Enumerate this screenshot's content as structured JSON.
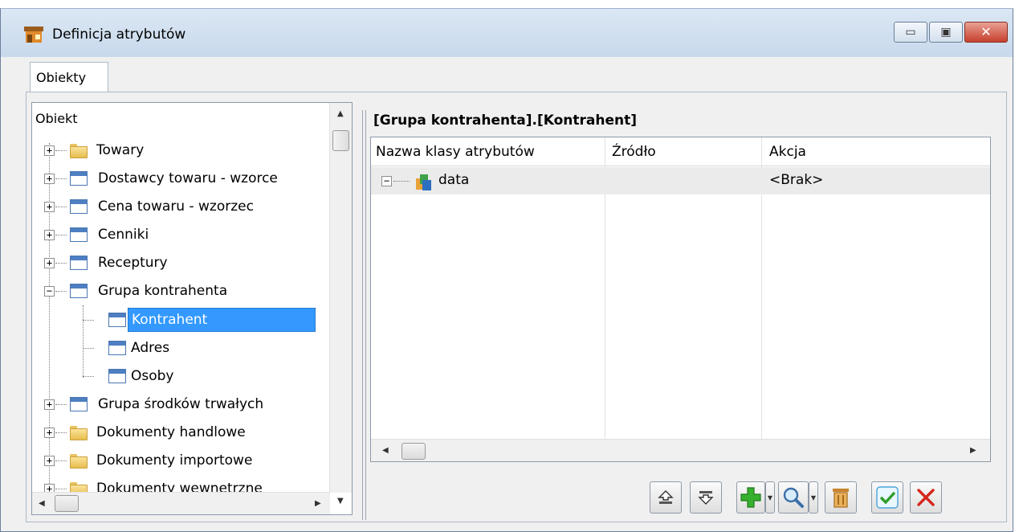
{
  "window": {
    "title": "Definicja atrybutów",
    "buttons": {
      "minimize": "▭",
      "maximize": "▣",
      "close": "✕"
    }
  },
  "tabs": [
    {
      "label": "Obiekty",
      "active": true
    }
  ],
  "tree": {
    "header": "Obiekt",
    "items": [
      {
        "label": "Towary",
        "icon": "folder-icon",
        "expander": "+",
        "level": 0
      },
      {
        "label": "Dostawcy towaru - wzorce",
        "icon": "window-icon",
        "expander": "+",
        "level": 0
      },
      {
        "label": "Cena towaru - wzorzec",
        "icon": "window-icon",
        "expander": "+",
        "level": 0
      },
      {
        "label": "Cenniki",
        "icon": "window-icon",
        "expander": "+",
        "level": 0
      },
      {
        "label": "Receptury",
        "icon": "window-icon",
        "expander": "+",
        "level": 0
      },
      {
        "label": "Grupa kontrahenta",
        "icon": "window-icon",
        "expander": "−",
        "level": 0
      },
      {
        "label": "Kontrahent",
        "icon": "window-icon",
        "level": 1,
        "selected": true
      },
      {
        "label": "Adres",
        "icon": "window-icon",
        "level": 1
      },
      {
        "label": "Osoby",
        "icon": "window-icon",
        "level": 1
      },
      {
        "label": "Grupa środków trwałych",
        "icon": "window-icon",
        "expander": "+",
        "level": 0
      },
      {
        "label": "Dokumenty handlowe",
        "icon": "folder-icon",
        "expander": "+",
        "level": 0
      },
      {
        "label": "Dokumenty importowe",
        "icon": "folder-icon",
        "expander": "+",
        "level": 0
      },
      {
        "label": "Dokumenty wewnętrzne",
        "icon": "folder-icon",
        "expander": "+",
        "level": 0
      }
    ]
  },
  "detail": {
    "path": "[Grupa kontrahenta].[Kontrahent]",
    "columns": [
      "Nazwa klasy atrybutów",
      "Źródło",
      "Akcja"
    ],
    "rows": [
      {
        "expander": "−",
        "name": "data",
        "source": "",
        "action": "<Brak>"
      }
    ]
  },
  "toolbar": {
    "buttons": [
      "move-up-icon",
      "move-down-icon",
      "add-icon",
      "search-icon",
      "delete-icon",
      "confirm-icon",
      "cancel-icon"
    ]
  },
  "colors": {
    "selection": "#3399ff",
    "add": "#37b02f",
    "confirm": "#2f9e2a",
    "cancel": "#d6261d",
    "delete": "#c8852c"
  }
}
